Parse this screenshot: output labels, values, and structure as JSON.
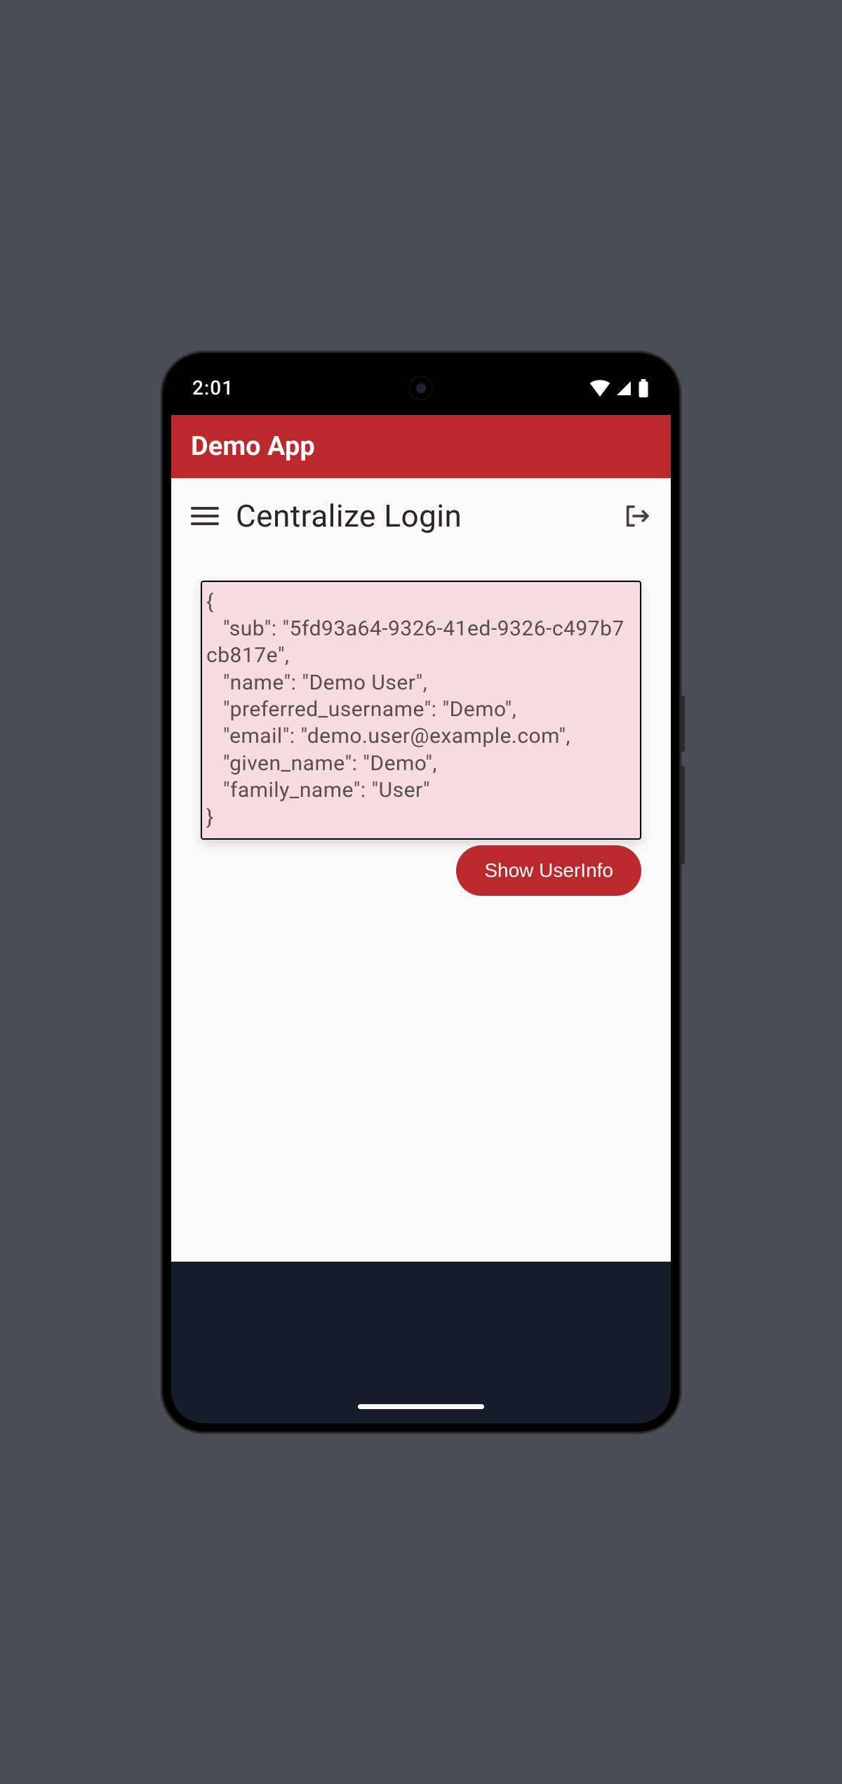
{
  "status": {
    "time": "2:01"
  },
  "appbar": {
    "title": "Demo App"
  },
  "page": {
    "title": "Centralize Login"
  },
  "userinfo_json": "{\n   \"sub\": \"5fd93a64-9326-41ed-9326-c497b7cb817e\",\n   \"name\": \"Demo User\",\n   \"preferred_username\": \"Demo\",\n   \"email\": \"demo.user@example.com\",\n   \"given_name\": \"Demo\",\n   \"family_name\": \"User\"\n}",
  "buttons": {
    "show_userinfo": "Show UserInfo"
  }
}
